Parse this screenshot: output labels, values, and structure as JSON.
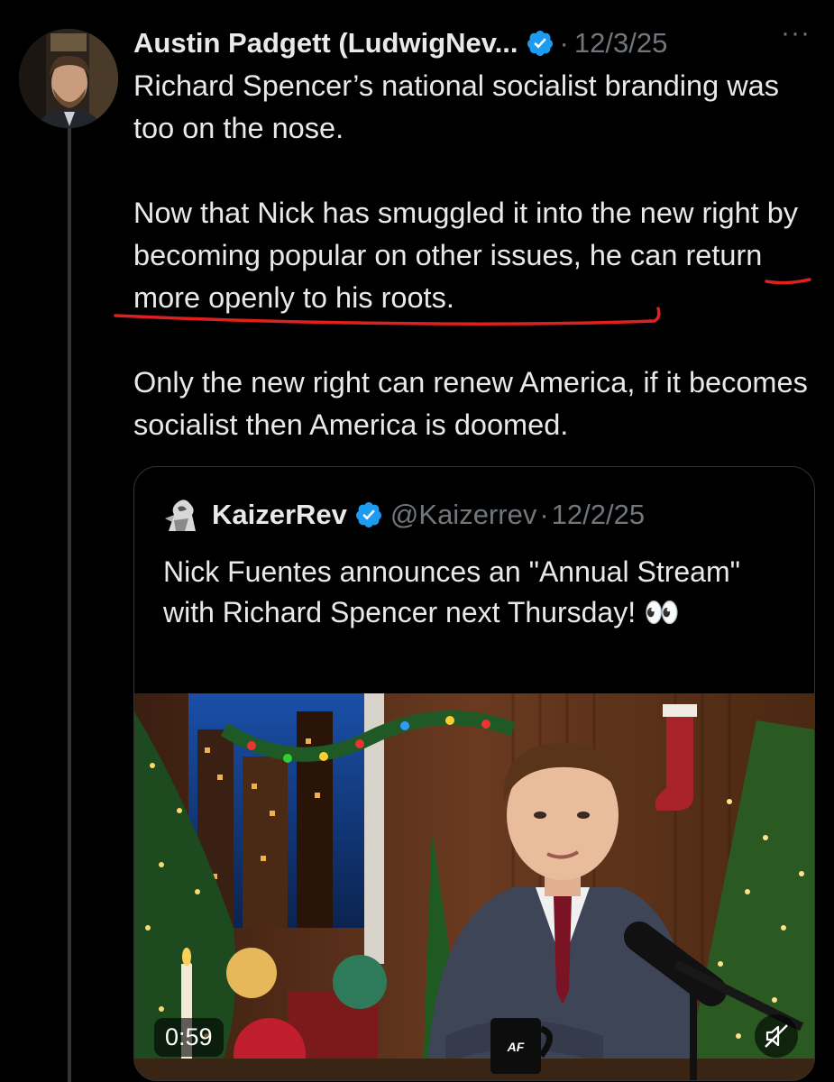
{
  "tweet": {
    "author_name": "Austin Padgett (LudwigNev...",
    "date": "12/3/25",
    "separator": "·",
    "more_label": "···",
    "paragraphs": [
      "Richard Spencer’s national socialist branding was too on the nose.",
      "Now that Nick has smuggled it into the new right by becoming popular on other issues, he can return more openly to his roots.",
      "Only the new right can renew America, if it becomes socialist then America is doomed."
    ]
  },
  "quoted_tweet": {
    "author_name": "KaizerRev",
    "handle": "@Kaizerrev",
    "separator": "·",
    "date": "12/2/25",
    "text": "Nick Fuentes announces an \"Annual Stream\" with Richard Spencer next Thursday! 👀",
    "video": {
      "duration": "0:59",
      "mug_logo_text": "AF",
      "muted_icon": "speaker-muted-icon"
    }
  },
  "colors": {
    "background": "#000000",
    "text": "#e7e9ea",
    "muted": "#71767b",
    "verified": "#1d9bf0",
    "annotation": "#e0201c"
  }
}
